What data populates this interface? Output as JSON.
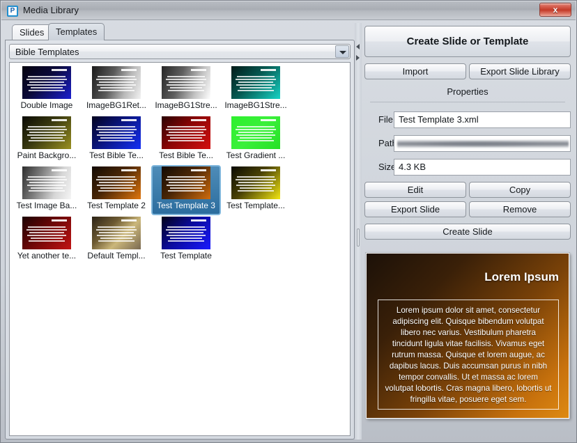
{
  "window": {
    "title": "Media Library",
    "app_icon": "P",
    "close_label": "x"
  },
  "tabs": [
    {
      "label": "Slides",
      "active": false
    },
    {
      "label": "Templates",
      "active": true
    }
  ],
  "library_selector": {
    "selected": "Bible Templates",
    "arrow_icon": "chevron-down-icon"
  },
  "thumbnails": [
    {
      "caption": "Double Image",
      "gradient": "linear-gradient(135deg,#05030e 0%,#0b0a3a 45%,#1b1fd0 100%)",
      "selected": false
    },
    {
      "caption": "ImageBG1Ret...",
      "gradient": "linear-gradient(110deg,#1b1b1b 0%,#5a5a5a 40%,#b9b9b9 70%,#f2f2f2 100%)",
      "selected": false
    },
    {
      "caption": "ImageBG1Stre...",
      "gradient": "linear-gradient(110deg,#262626 0%,#5f5f5f 38%,#c4c4c4 72%,#ffffff 100%)",
      "selected": false
    },
    {
      "caption": "ImageBG1Stre...",
      "gradient": "linear-gradient(135deg,#021a18 0%,#065a52 45%,#17d4c6 100%)",
      "selected": false
    },
    {
      "caption": "Paint Backgro...",
      "gradient": "linear-gradient(135deg,#0a0a04 0%,#3a3a10 45%,#9a9020 100%)",
      "selected": false
    },
    {
      "caption": "Test Bible Te...",
      "gradient": "linear-gradient(135deg,#03031e 0%,#0a1580 45%,#1530f5 100%)",
      "selected": false
    },
    {
      "caption": "Test Bible Te...",
      "gradient": "linear-gradient(135deg,#2a0202 0%,#8a0505 45%,#d41010 100%)",
      "selected": false
    },
    {
      "caption": "Test Gradient ...",
      "gradient": "linear-gradient(135deg,#2ef02e 0%,#3af03a 50%,#27e027 100%)",
      "selected": false
    },
    {
      "caption": "Test Image Ba...",
      "gradient": "linear-gradient(110deg,#2e2e2e 0%,#7d7d7d 35%,#d6d6d6 70%,#f5f5f5 100%)",
      "selected": false
    },
    {
      "caption": "Test Template 2",
      "gradient": "linear-gradient(135deg,#120a03 0%,#4a2606 45%,#e0760e 100%)",
      "selected": false
    },
    {
      "caption": "Test Template 3",
      "gradient": "linear-gradient(135deg,#120a03 0%,#4a2606 45%,#d06c0d 100%)",
      "selected": true
    },
    {
      "caption": "Test Template...",
      "gradient": "linear-gradient(135deg,#0a0a02 0%,#4a4205 45%,#f2e612 100%)",
      "selected": false
    },
    {
      "caption": "Yet another te...",
      "gradient": "linear-gradient(135deg,#1c0202 0%,#6a0606 45%,#c21414 100%)",
      "selected": false
    },
    {
      "caption": "Default Templ...",
      "gradient": "linear-gradient(135deg,#2b2216 0%,#6d5a32 35%,#cbb77a 62%,#7a6a52 100%)",
      "selected": false
    },
    {
      "caption": "Test Template",
      "gradient": "linear-gradient(135deg,#020216 0%,#0a0a9a 45%,#1a1aff 100%)",
      "selected": false
    }
  ],
  "right_panel": {
    "create_main_label": "Create Slide or Template",
    "import_label": "Import",
    "export_library_label": "Export Slide Library",
    "properties_title": "Properties",
    "fields": {
      "file_label": "File",
      "file_value": "Test Template 3.xml",
      "path_label": "Path",
      "path_value": "",
      "size_label": "Size",
      "size_value": "4.3 KB"
    },
    "edit_label": "Edit",
    "copy_label": "Copy",
    "export_slide_label": "Export Slide",
    "remove_label": "Remove",
    "create_slide_label": "Create Slide"
  },
  "preview": {
    "title": "Lorem Ipsum",
    "body": "Lorem ipsum dolor sit amet, consectetur adipiscing elit. Quisque bibendum volutpat libero nec varius. Vestibulum pharetra tincidunt ligula vitae facilisis. Vivamus eget rutrum massa. Quisque et lorem augue, ac dapibus lacus. Duis accumsan purus in nibh tempor convallis. Ut et massa ac lorem volutpat lobortis. Cras magna libero, lobortis ut fringilla vitae, posuere eget sem."
  },
  "colors": {
    "selection_blue": "#2c6d9e",
    "close_red": "#c43a28",
    "panel_gray": "#d5dae1",
    "preview_accent": "#de8a12"
  }
}
